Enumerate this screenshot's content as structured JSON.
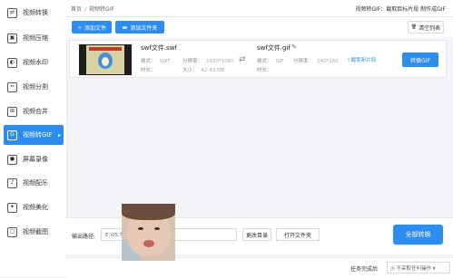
{
  "sidebar": {
    "items": [
      {
        "label": "视频转换",
        "icon": "convert-icon",
        "glyph": "⇄",
        "active": false
      },
      {
        "label": "视频压缩",
        "icon": "compress-icon",
        "glyph": "▣",
        "active": false
      },
      {
        "label": "视频水印",
        "icon": "watermark-icon",
        "glyph": "◐",
        "active": false
      },
      {
        "label": "视频分割",
        "icon": "split-icon",
        "glyph": "✂",
        "active": false
      },
      {
        "label": "视频合并",
        "icon": "merge-icon",
        "glyph": "⊞",
        "active": false
      },
      {
        "label": "视频转GIF",
        "icon": "gif-icon",
        "glyph": "G",
        "active": true,
        "arrow": "▸"
      },
      {
        "label": "屏幕录像",
        "icon": "record-icon",
        "glyph": "●",
        "active": false
      },
      {
        "label": "视频配乐",
        "icon": "music-icon",
        "glyph": "♪",
        "active": false
      },
      {
        "label": "视频美化",
        "icon": "beautify-icon",
        "glyph": "✦",
        "active": false
      },
      {
        "label": "视频截图",
        "icon": "screenshot-icon",
        "glyph": "▢",
        "active": false
      }
    ]
  },
  "breadcrumb": {
    "home": "首页",
    "separator": "/",
    "current": "视频转GIF"
  },
  "topbar": {
    "right_text": "视频转GIF：截取目标片段 制作成GIF"
  },
  "toolbar": {
    "add_file": "＋ 添加文件",
    "add_folder": "添加文件夹",
    "clear_list": "清空列表",
    "folder_glyph": "▬",
    "trash_glyph": "🗑"
  },
  "file": {
    "source_name": "swf文件.swf",
    "format_label": "格式：",
    "format_value": "SWF",
    "resolution_label": "分辨率：",
    "resolution_value": "1920*1080",
    "duration_label": "时长：",
    "size_label": "大小：",
    "size_value": "42.43 MB",
    "swap_glyph": "⇄",
    "target_name": "swf文件.gif",
    "edit_glyph": "✎",
    "target_format_label": "格式：",
    "target_format_value": "GIF",
    "target_resolution_label": "分辨率：",
    "target_resolution_value": "240*160",
    "target_duration_label": "时长：",
    "cut_label": "⟟ 截取新片段",
    "convert_label": "转换GIF"
  },
  "output": {
    "label": "输出路径:",
    "path_value": "E:\\05.常…文档素材",
    "change_dir": "更改目录",
    "open_folder": "打开文件夹",
    "convert_all": "全部转换"
  },
  "status": {
    "label": "任务完成后",
    "select_value": "◷ 不采取任何操作 ▾"
  },
  "colors": {
    "accent": "#2d8cf0"
  }
}
